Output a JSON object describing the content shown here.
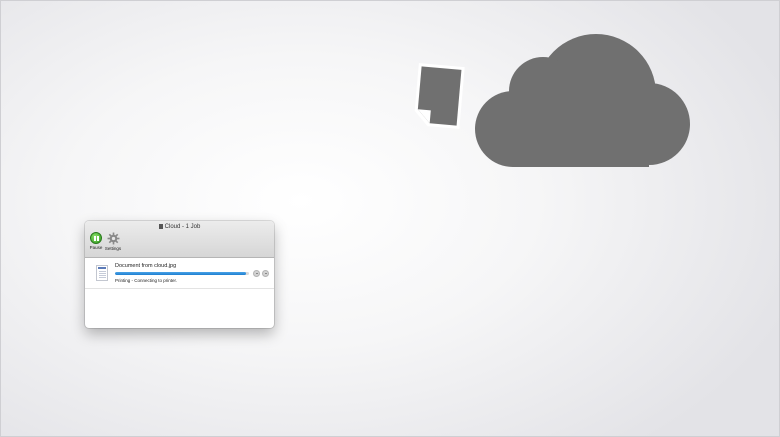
{
  "window": {
    "title": "Cloud - 1 Job"
  },
  "toolbar": {
    "pause_label": "Pause",
    "settings_label": "Settings"
  },
  "job": {
    "name": "Document from cloud.jpg",
    "status": "Printing - Connecting to printer.",
    "progress": 0.98
  },
  "icons": {
    "document": "document-icon",
    "cloud": "cloud-icon",
    "pause": "pause-icon",
    "settings": "gear-icon"
  },
  "colors": {
    "graphic_gray": "#707070",
    "progress_blue": "#1d7fd0",
    "pause_green": "#3aae25"
  }
}
